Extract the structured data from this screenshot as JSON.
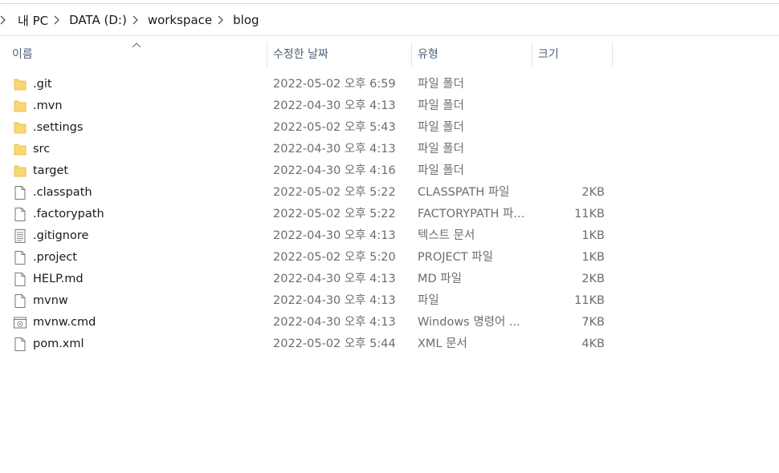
{
  "breadcrumb": {
    "items": [
      "내 PC",
      "DATA (D:)",
      "workspace",
      "blog"
    ]
  },
  "columns": {
    "name": "이름",
    "date": "수정한 날짜",
    "type": "유형",
    "size": "크기",
    "sort": "name-ascending"
  },
  "files": [
    {
      "name": ".git",
      "date": "2022-05-02 오후 6:59",
      "type": "파일 폴더",
      "size": "",
      "icon": "folder-icon"
    },
    {
      "name": ".mvn",
      "date": "2022-04-30 오후 4:13",
      "type": "파일 폴더",
      "size": "",
      "icon": "folder-icon"
    },
    {
      "name": ".settings",
      "date": "2022-05-02 오후 5:43",
      "type": "파일 폴더",
      "size": "",
      "icon": "folder-icon"
    },
    {
      "name": "src",
      "date": "2022-04-30 오후 4:13",
      "type": "파일 폴더",
      "size": "",
      "icon": "folder-icon"
    },
    {
      "name": "target",
      "date": "2022-04-30 오후 4:16",
      "type": "파일 폴더",
      "size": "",
      "icon": "folder-icon"
    },
    {
      "name": ".classpath",
      "date": "2022-05-02 오후 5:22",
      "type": "CLASSPATH 파일",
      "size": "2KB",
      "icon": "file-icon"
    },
    {
      "name": ".factorypath",
      "date": "2022-05-02 오후 5:22",
      "type": "FACTORYPATH 파...",
      "size": "11KB",
      "icon": "file-icon"
    },
    {
      "name": ".gitignore",
      "date": "2022-04-30 오후 4:13",
      "type": "텍스트 문서",
      "size": "1KB",
      "icon": "text-file-icon"
    },
    {
      "name": ".project",
      "date": "2022-05-02 오후 5:20",
      "type": "PROJECT 파일",
      "size": "1KB",
      "icon": "file-icon"
    },
    {
      "name": "HELP.md",
      "date": "2022-04-30 오후 4:13",
      "type": "MD 파일",
      "size": "2KB",
      "icon": "file-icon"
    },
    {
      "name": "mvnw",
      "date": "2022-04-30 오후 4:13",
      "type": "파일",
      "size": "11KB",
      "icon": "file-icon"
    },
    {
      "name": "mvnw.cmd",
      "date": "2022-04-30 오후 4:13",
      "type": "Windows 명령어 ...",
      "size": "7KB",
      "icon": "cmd-file-icon"
    },
    {
      "name": "pom.xml",
      "date": "2022-05-02 오후 5:44",
      "type": "XML 문서",
      "size": "4KB",
      "icon": "file-icon"
    }
  ],
  "colors": {
    "folder": "#f8d775",
    "folder_dark": "#e8b530",
    "header_text": "#4c607a",
    "secondary_text": "#6d6d6d"
  }
}
